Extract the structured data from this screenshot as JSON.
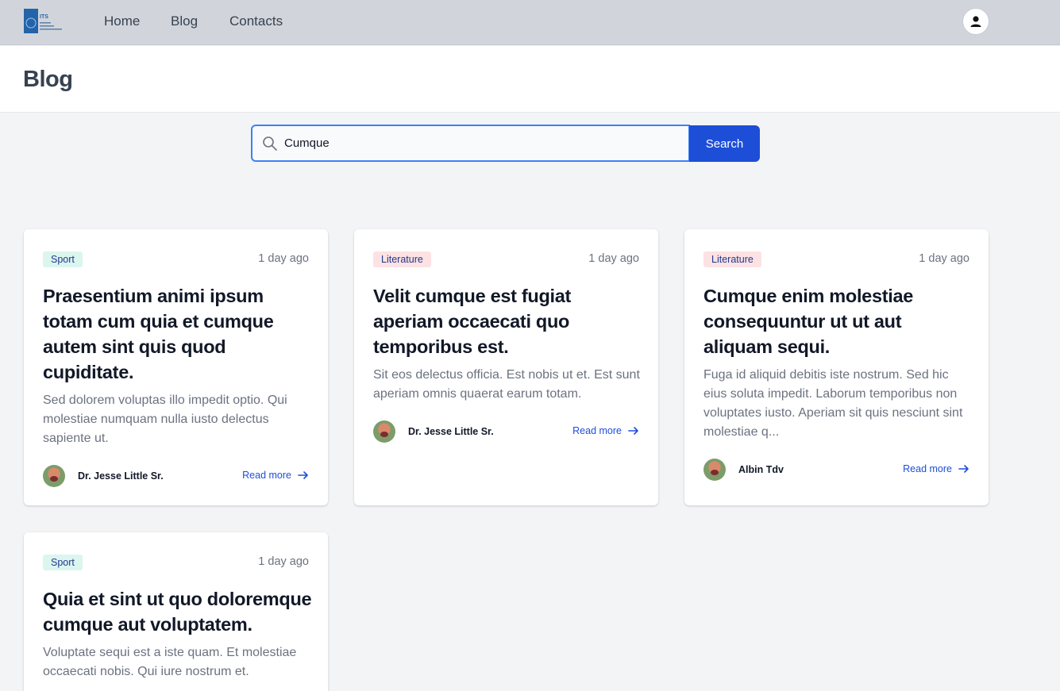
{
  "nav": {
    "logo_text": "ITS",
    "links": [
      {
        "label": "Home"
      },
      {
        "label": "Blog"
      },
      {
        "label": "Contacts"
      }
    ],
    "user_icon": "user-icon"
  },
  "header": {
    "title": "Blog"
  },
  "search": {
    "value": "Cumque",
    "button_label": "Search",
    "icon": "search-icon"
  },
  "colors": {
    "accent": "#1d4ed8",
    "nav_bg": "#d1d5db",
    "sport_badge": "#dcf5ef",
    "literature_badge": "#fde2e4"
  },
  "posts": [
    {
      "category": "Sport",
      "time": "1 day ago",
      "title": "Praesentium animi ipsum totam cum quia et cumque autem sint quis quod cupiditate.",
      "excerpt": "Sed dolorem voluptas illo impedit optio. Qui molestiae numquam nulla iusto delectus sapiente ut.",
      "author": "Dr. Jesse Little Sr.",
      "read_more": "Read more"
    },
    {
      "category": "Literature",
      "time": "1 day ago",
      "title": "Velit cumque est fugiat aperiam occaecati quo temporibus est.",
      "excerpt": "Sit eos delectus officia. Est nobis ut et. Est sunt aperiam omnis quaerat earum totam.",
      "author": "Dr. Jesse Little Sr.",
      "read_more": "Read more"
    },
    {
      "category": "Literature",
      "time": "1 day ago",
      "title": "Cumque enim molestiae consequuntur ut ut aut aliquam sequi.",
      "excerpt": "Fuga id aliquid debitis iste nostrum. Sed hic eius soluta impedit. Laborum temporibus non voluptates iusto. Aperiam sit quis nesciunt sint molestiae q...",
      "author": "Albin Tdv",
      "read_more": "Read more"
    },
    {
      "category": "Sport",
      "time": "1 day ago",
      "title": "Quia et sint ut quo doloremque cumque aut voluptatem.",
      "excerpt": "Voluptate sequi est a iste quam. Et molestiae occaecati nobis. Qui iure nostrum et.",
      "author": "",
      "read_more": ""
    }
  ]
}
